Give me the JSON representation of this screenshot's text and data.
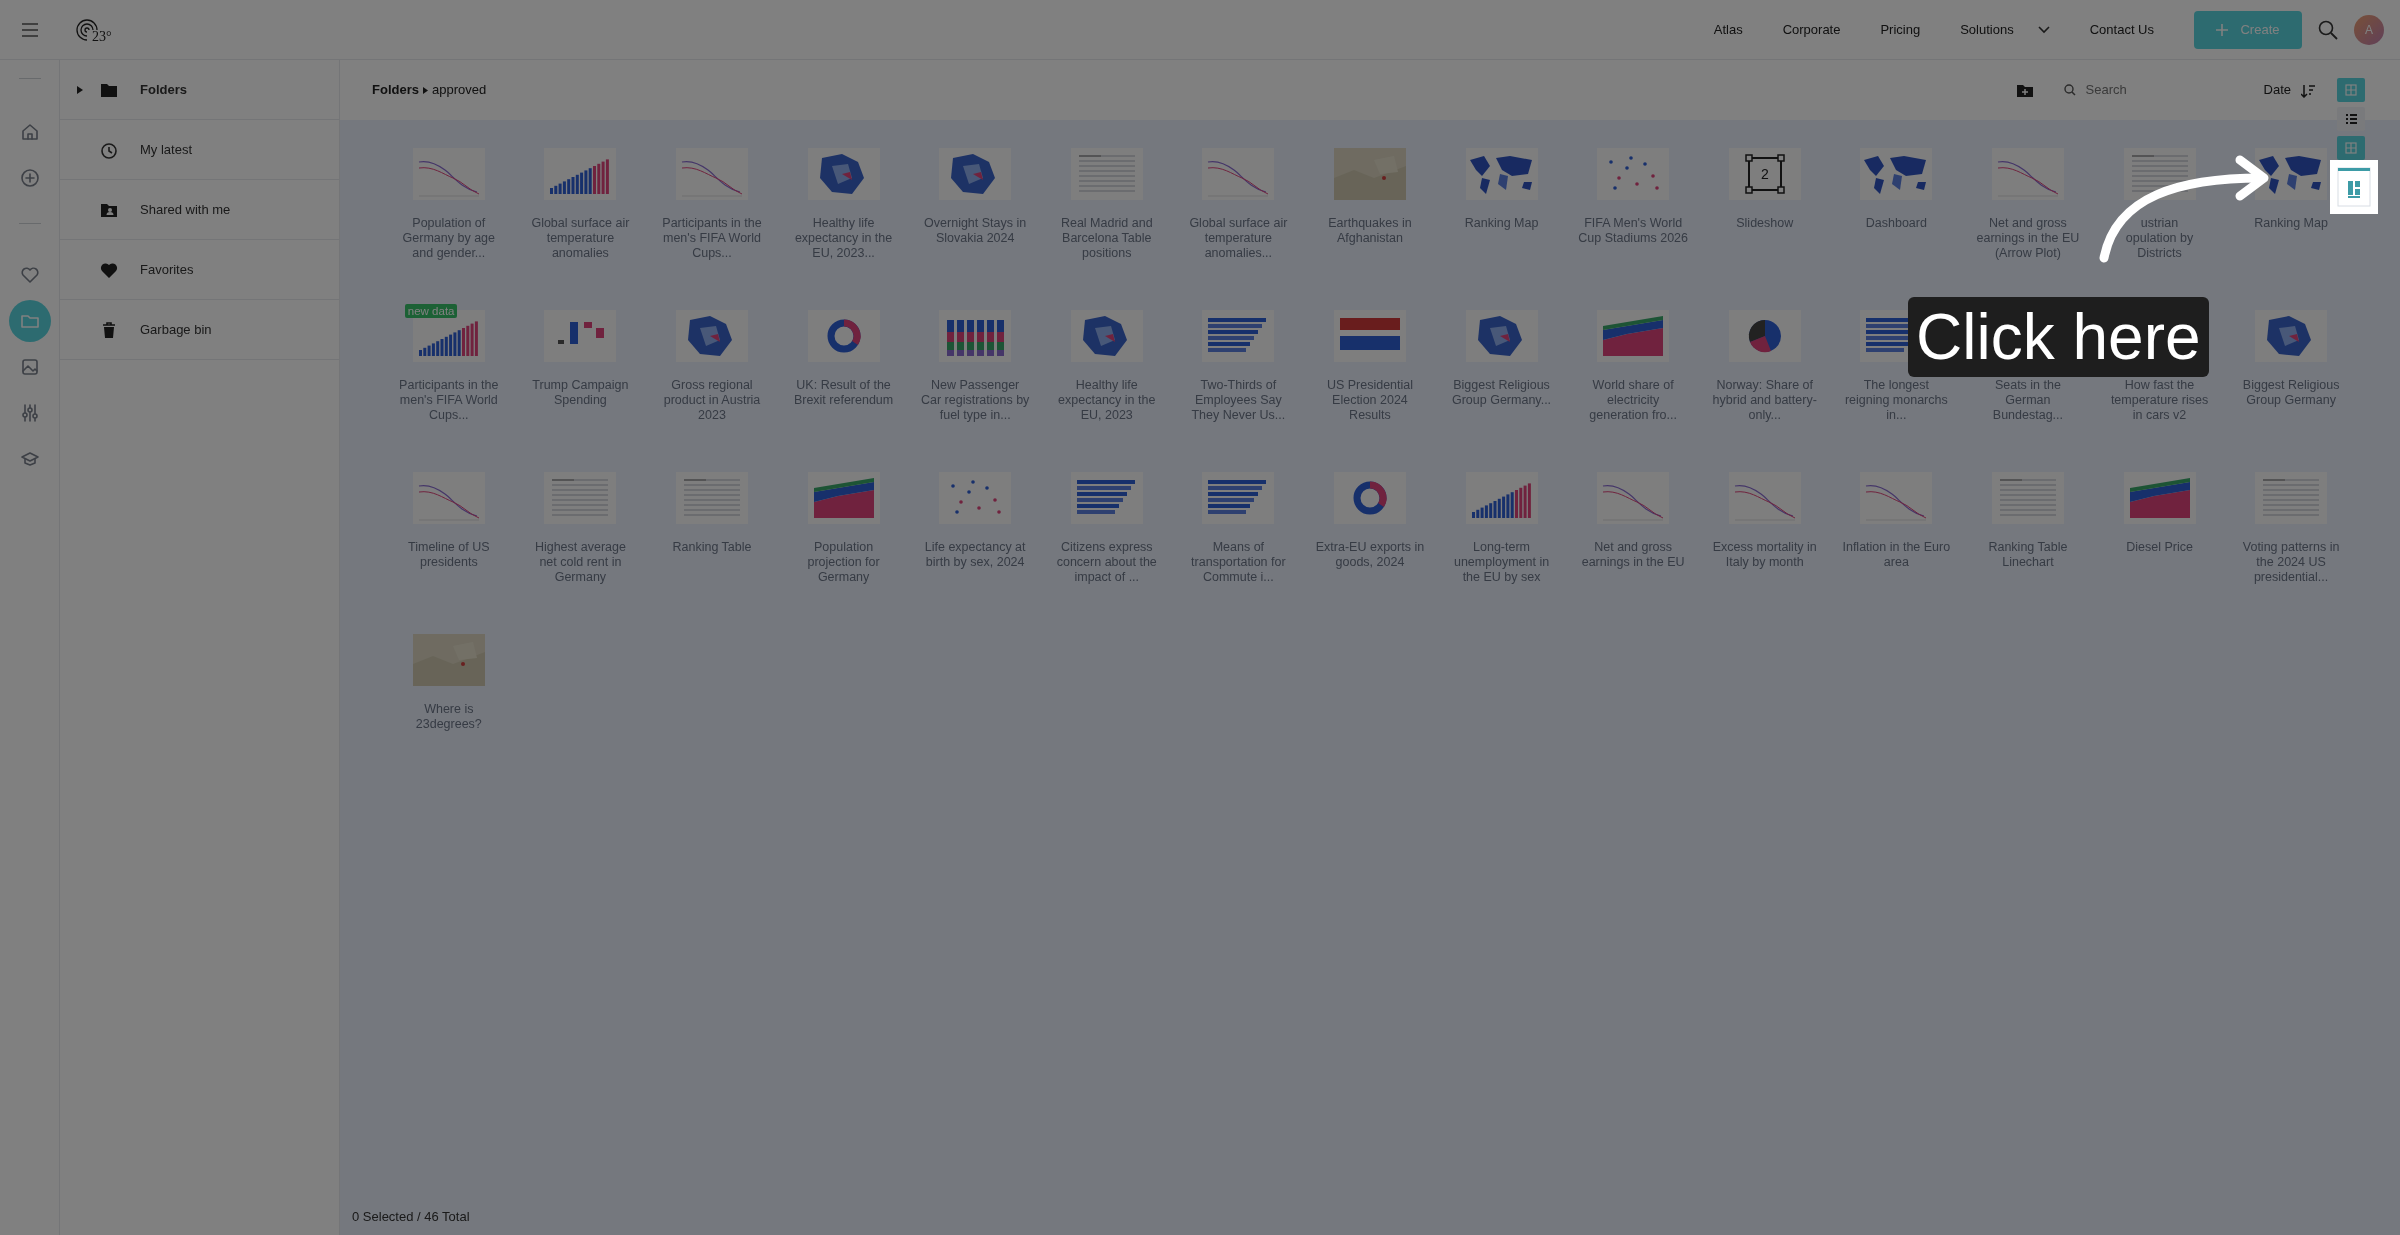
{
  "topbar": {
    "logo_text": "23°",
    "nav": [
      {
        "label": "Atlas",
        "dropdown": false
      },
      {
        "label": "Corporate",
        "dropdown": false
      },
      {
        "label": "Pricing",
        "dropdown": false
      },
      {
        "label": "Solutions",
        "dropdown": true
      },
      {
        "label": "Contact Us",
        "dropdown": false
      }
    ],
    "create_button": "Create",
    "avatar": "A"
  },
  "rail": [
    {
      "kind": "home",
      "selected": false
    },
    {
      "kind": "add",
      "selected": false
    },
    {
      "kind": "divider"
    },
    {
      "kind": "heart",
      "selected": false
    },
    {
      "kind": "folder",
      "selected": true
    },
    {
      "kind": "image",
      "selected": false
    },
    {
      "kind": "sliders",
      "selected": false
    },
    {
      "kind": "hat",
      "selected": false
    }
  ],
  "folders_panel": [
    {
      "kind": "root",
      "label": "Folders",
      "expanded": false
    },
    {
      "kind": "recent",
      "label": "My latest"
    },
    {
      "kind": "shared",
      "label": "Shared with me"
    },
    {
      "kind": "favorites",
      "label": "Favorites"
    },
    {
      "kind": "trash",
      "label": "Garbage bin"
    }
  ],
  "breadcrumb": [
    "Folders",
    "approved"
  ],
  "toolbar": {
    "search": {
      "placeholder": "Search"
    },
    "sort_label": "Date",
    "views": [
      {
        "kind": "grid",
        "selected": true
      },
      {
        "kind": "list",
        "selected": false
      },
      {
        "kind": "grid",
        "selected": true
      }
    ]
  },
  "items": [
    {
      "title": "Population of Germany by age and gender...",
      "kind": "line"
    },
    {
      "title": "Global surface air temperature anomalies",
      "kind": "bar"
    },
    {
      "title": "Participants in the men's FIFA World Cups...",
      "kind": "line"
    },
    {
      "title": "Healthy life expectancy in the EU, 2023...",
      "kind": "map"
    },
    {
      "title": "Overnight Stays in Slovakia 2024",
      "kind": "map"
    },
    {
      "title": "Real Madrid and Barcelona Table positions",
      "kind": "table"
    },
    {
      "title": "Global surface air temperature anomalies...",
      "kind": "line"
    },
    {
      "title": "Earthquakes in Afghanistan",
      "kind": "terrain"
    },
    {
      "title": "Ranking Map",
      "kind": "world"
    },
    {
      "title": "FIFA Men's World Cup Stadiums 2026",
      "kind": "scatter"
    },
    {
      "title": "Slideshow",
      "kind": "slideshow",
      "thumb_text": "2"
    },
    {
      "title": "Dashboard",
      "kind": "world"
    },
    {
      "title": "Net and gross earnings in the EU (Arrow Plot)",
      "kind": "line"
    },
    {
      "title": "ustrian\nopulation by\nDistricts",
      "kind": "table"
    },
    {
      "title": "Ranking Map",
      "kind": "world"
    },
    {
      "title": "Participants in the men's FIFA World Cups...",
      "kind": "bar",
      "badge": "new data"
    },
    {
      "title": "Trump Campaign Spending",
      "kind": "waterfall"
    },
    {
      "title": "Gross regional product in Austria 2023",
      "kind": "map"
    },
    {
      "title": "UK: Result of the Brexit referendum",
      "kind": "donut"
    },
    {
      "title": "New Passenger Car registrations by fuel type in...",
      "kind": "stacked"
    },
    {
      "title": "Healthy life expectancy in the EU, 2023",
      "kind": "map"
    },
    {
      "title": "Two-Thirds of Employees Say They Never Us...",
      "kind": "hbar"
    },
    {
      "title": "US Presidential Election 2024 Results",
      "kind": "flag"
    },
    {
      "title": "Biggest Religious Group Germany...",
      "kind": "map"
    },
    {
      "title": "World share of electricity generation fro...",
      "kind": "area"
    },
    {
      "title": "Norway: Share of hybrid and battery-only...",
      "kind": "pie"
    },
    {
      "title": "The longest reigning monarchs in...",
      "kind": "hbar"
    },
    {
      "title": "Seats in the German Bundestag..."
    },
    {
      "title": "How fast the temperature rises in cars v2"
    },
    {
      "title": "Biggest Religious Group Germany",
      "kind": "map"
    },
    {
      "title": "Timeline of US presidents",
      "kind": "line"
    },
    {
      "title": "Highest average net cold rent in Germany",
      "kind": "table"
    },
    {
      "title": "Ranking Table",
      "kind": "table"
    },
    {
      "title": "Population projection for Germany",
      "kind": "area"
    },
    {
      "title": "Life expectancy at birth by sex, 2024",
      "kind": "scatter"
    },
    {
      "title": "Citizens express concern about the impact of ...",
      "kind": "hbar"
    },
    {
      "title": "Means of transportation for Commute i...",
      "kind": "hbar"
    },
    {
      "title": "Extra-EU exports in goods, 2024",
      "kind": "donut"
    },
    {
      "title": "Long-term unemployment in the EU by sex",
      "kind": "bar"
    },
    {
      "title": "Net and gross earnings in the EU",
      "kind": "line"
    },
    {
      "title": "Excess mortality in Italy by month",
      "kind": "line"
    },
    {
      "title": "Inflation in the Euro area",
      "kind": "line"
    },
    {
      "title": "Ranking Table Linechart",
      "kind": "table"
    },
    {
      "title": "Diesel Price",
      "kind": "area"
    },
    {
      "title": "Voting patterns in the 2024 US presidential...",
      "kind": "table"
    },
    {
      "title": "Where is 23degrees?",
      "kind": "terrain"
    }
  ],
  "footer": "0 Selected / 46 Total",
  "tour": {
    "highlight": {
      "kind": "dashboard"
    },
    "callout": "Click here"
  }
}
